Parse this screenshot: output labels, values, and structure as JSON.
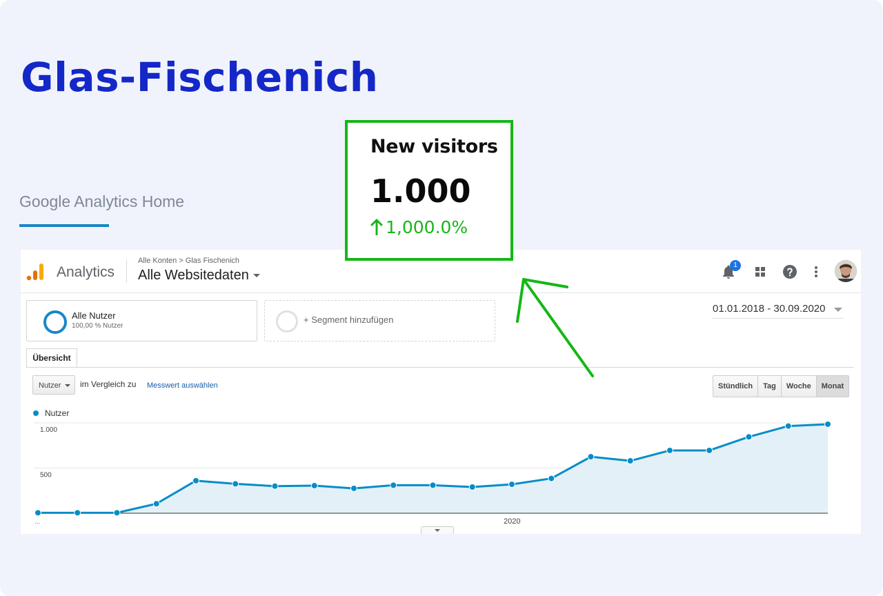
{
  "title": "Glas-Fischenich",
  "subtitle": "Google Analytics Home",
  "kpi": {
    "label": "New visitors",
    "value": "1.000",
    "change": "1,000.0%",
    "color": "#14b714"
  },
  "analytics": {
    "app_name": "Analytics",
    "breadcrumb": "Alle Konten > Glas Fischenich",
    "view": "Alle Websitedaten",
    "notification_count": "1",
    "segments": {
      "all_users_name": "Alle Nutzer",
      "all_users_sub": "100,00 % Nutzer",
      "add_label": "+ Segment hinzufügen"
    },
    "date_range": "01.01.2018 - 30.09.2020",
    "tab": "Übersicht",
    "metric_select": "Nutzer",
    "compare_text": "im Vergleich zu",
    "compare_link": "Messwert auswählen",
    "granularity": [
      "Stündlich",
      "Tag",
      "Woche",
      "Monat"
    ],
    "granularity_active": "Monat",
    "accent": "#058dc7"
  },
  "chart_data": {
    "type": "area",
    "series": [
      {
        "name": "Nutzer",
        "values": [
          5,
          5,
          5,
          105,
          360,
          325,
          300,
          305,
          275,
          310,
          310,
          290,
          320,
          385,
          625,
          580,
          695,
          695,
          845,
          965,
          985
        ]
      }
    ],
    "ylim": [
      0,
      1000
    ],
    "yticks": [
      "1.000",
      "500"
    ],
    "xtick_labels": [
      "...",
      "2020"
    ],
    "legend": "top-left",
    "grid": true
  }
}
